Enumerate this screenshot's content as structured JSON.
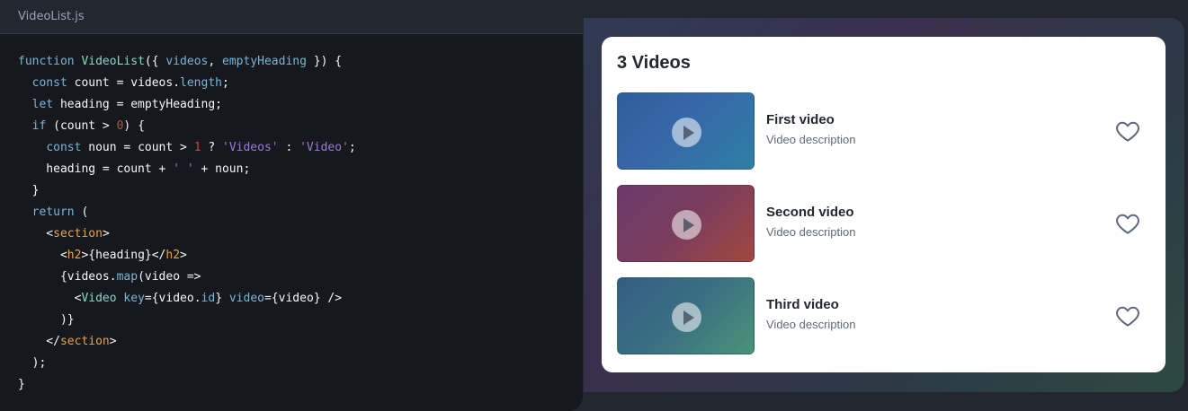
{
  "editor": {
    "filename": "VideoList.js",
    "lines": [
      [
        {
          "t": "function ",
          "c": "kw"
        },
        {
          "t": "VideoList",
          "c": "fn"
        },
        {
          "t": "({ ",
          "c": "plain"
        },
        {
          "t": "videos",
          "c": "kw"
        },
        {
          "t": ", ",
          "c": "plain"
        },
        {
          "t": "emptyHeading",
          "c": "kw"
        },
        {
          "t": " }) {",
          "c": "plain"
        }
      ],
      [
        {
          "t": "  ",
          "c": "plain"
        },
        {
          "t": "const ",
          "c": "kw"
        },
        {
          "t": "count = videos.",
          "c": "plain"
        },
        {
          "t": "length",
          "c": "prop"
        },
        {
          "t": ";",
          "c": "plain"
        }
      ],
      [
        {
          "t": "  ",
          "c": "plain"
        },
        {
          "t": "let ",
          "c": "kw"
        },
        {
          "t": "heading = emptyHeading;",
          "c": "plain"
        }
      ],
      [
        {
          "t": "  ",
          "c": "plain"
        },
        {
          "t": "if ",
          "c": "kw"
        },
        {
          "t": "(count > ",
          "c": "plain"
        },
        {
          "t": "0",
          "c": "num"
        },
        {
          "t": ") {",
          "c": "plain"
        }
      ],
      [
        {
          "t": "    ",
          "c": "plain"
        },
        {
          "t": "const ",
          "c": "kw"
        },
        {
          "t": "noun = count > ",
          "c": "plain"
        },
        {
          "t": "1",
          "c": "num"
        },
        {
          "t": " ? ",
          "c": "plain"
        },
        {
          "t": "'Videos'",
          "c": "str"
        },
        {
          "t": " : ",
          "c": "plain"
        },
        {
          "t": "'Video'",
          "c": "str"
        },
        {
          "t": ";",
          "c": "plain"
        }
      ],
      [
        {
          "t": "    heading = count + ",
          "c": "plain"
        },
        {
          "t": "' '",
          "c": "str"
        },
        {
          "t": " + noun;",
          "c": "plain"
        }
      ],
      [
        {
          "t": "  }",
          "c": "plain"
        }
      ],
      [
        {
          "t": "  ",
          "c": "plain"
        },
        {
          "t": "return",
          "c": "kw"
        },
        {
          "t": " (",
          "c": "plain"
        }
      ],
      [
        {
          "t": "    <",
          "c": "plain"
        },
        {
          "t": "section",
          "c": "tag"
        },
        {
          "t": ">",
          "c": "plain"
        }
      ],
      [
        {
          "t": "      <",
          "c": "plain"
        },
        {
          "t": "h2",
          "c": "tag"
        },
        {
          "t": ">{heading}</",
          "c": "plain"
        },
        {
          "t": "h2",
          "c": "tag"
        },
        {
          "t": ">",
          "c": "plain"
        }
      ],
      [
        {
          "t": "      {videos.",
          "c": "plain"
        },
        {
          "t": "map",
          "c": "prop"
        },
        {
          "t": "(video =>",
          "c": "plain"
        }
      ],
      [
        {
          "t": "        <",
          "c": "plain"
        },
        {
          "t": "Video ",
          "c": "fn"
        },
        {
          "t": "key",
          "c": "attr"
        },
        {
          "t": "={video.",
          "c": "plain"
        },
        {
          "t": "id",
          "c": "prop"
        },
        {
          "t": "} ",
          "c": "plain"
        },
        {
          "t": "video",
          "c": "attr"
        },
        {
          "t": "={video} />",
          "c": "plain"
        }
      ],
      [
        {
          "t": "      )}",
          "c": "plain"
        }
      ],
      [
        {
          "t": "    </",
          "c": "plain"
        },
        {
          "t": "section",
          "c": "tag"
        },
        {
          "t": ">",
          "c": "plain"
        }
      ],
      [
        {
          "t": "  );",
          "c": "plain"
        }
      ],
      [
        {
          "t": "}",
          "c": "plain"
        }
      ]
    ]
  },
  "preview": {
    "heading": "3 Videos",
    "videos": [
      {
        "title": "First video",
        "description": "Video description",
        "like_icon": "heart-outline-icon",
        "play_icon": "play-icon"
      },
      {
        "title": "Second video",
        "description": "Video description",
        "like_icon": "heart-outline-icon",
        "play_icon": "play-icon"
      },
      {
        "title": "Third video",
        "description": "Video description",
        "like_icon": "heart-outline-icon",
        "play_icon": "play-icon"
      }
    ]
  }
}
